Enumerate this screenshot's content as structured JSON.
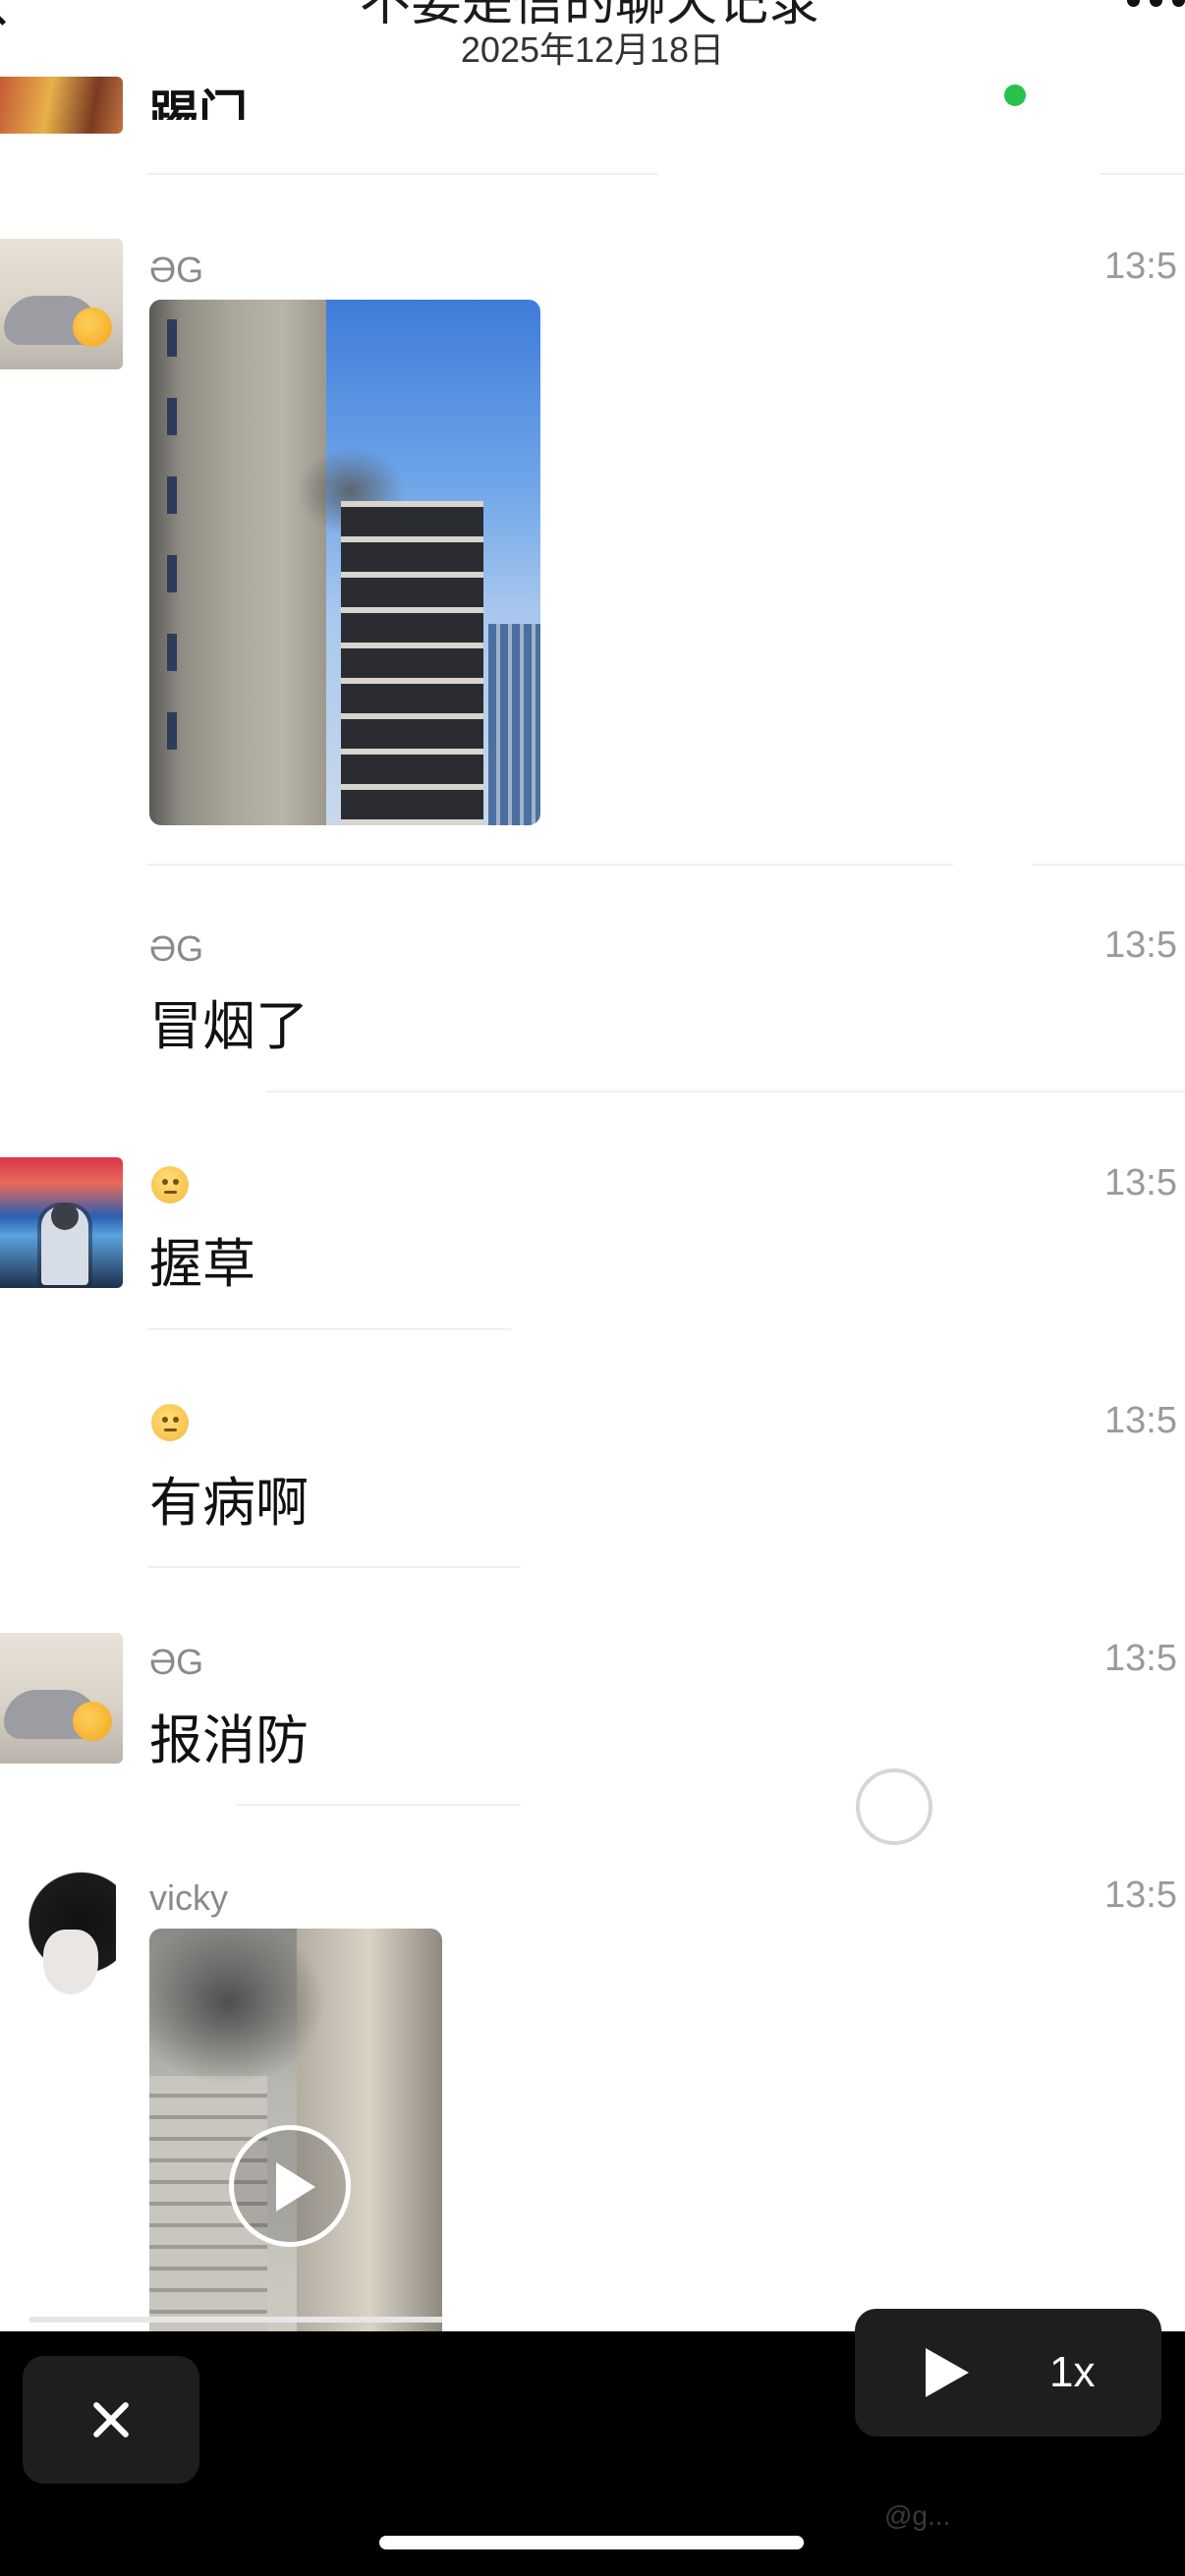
{
  "header": {
    "title": "不要是信的聊天记录",
    "date": "2025年12月18日"
  },
  "top_item": {
    "text": "踢门",
    "status_color": "#27c24c"
  },
  "messages": [
    {
      "sender": "ƏG",
      "time": "13:5",
      "type": "image",
      "content": ""
    },
    {
      "sender": "ƏG",
      "time": "13:5",
      "type": "text",
      "content": "冒烟了"
    },
    {
      "sender": "",
      "sender_icon": "emoji-face-icon",
      "time": "13:5",
      "type": "text",
      "content": "握草"
    },
    {
      "sender": "",
      "sender_icon": "emoji-face-icon",
      "time": "13:5",
      "type": "text",
      "content": "有病啊"
    },
    {
      "sender": "ƏG",
      "time": "13:5",
      "type": "text",
      "content": "报消防"
    },
    {
      "sender": "vicky",
      "time": "13:5",
      "type": "video",
      "content": ""
    }
  ],
  "player_bar": {
    "close_icon": "close-icon",
    "play_icon": "play-icon",
    "speed": "1x"
  },
  "watermark": "@g..."
}
